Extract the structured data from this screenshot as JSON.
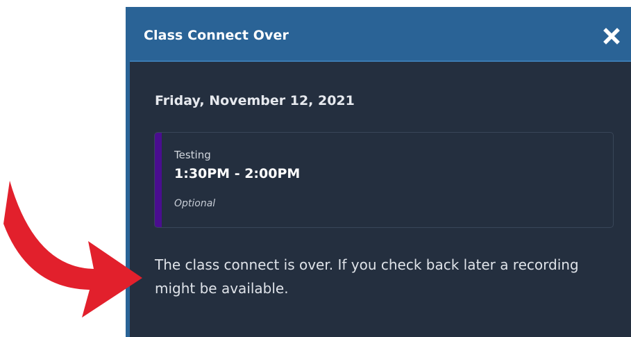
{
  "dialog": {
    "title": "Class Connect Over",
    "close_icon": "close-x-icon",
    "date": "Friday, November 12, 2021",
    "event": {
      "name": "Testing",
      "time": "1:30PM - 2:00PM",
      "tag": "Optional"
    },
    "message": "The class connect is over. If you check back later a recording might be available."
  },
  "annotation": {
    "icon": "curved-arrow-icon",
    "color": "#e2202c"
  },
  "colors": {
    "header": "#2a6396",
    "panel": "#242f3f",
    "accent": "#4a0e8f"
  }
}
